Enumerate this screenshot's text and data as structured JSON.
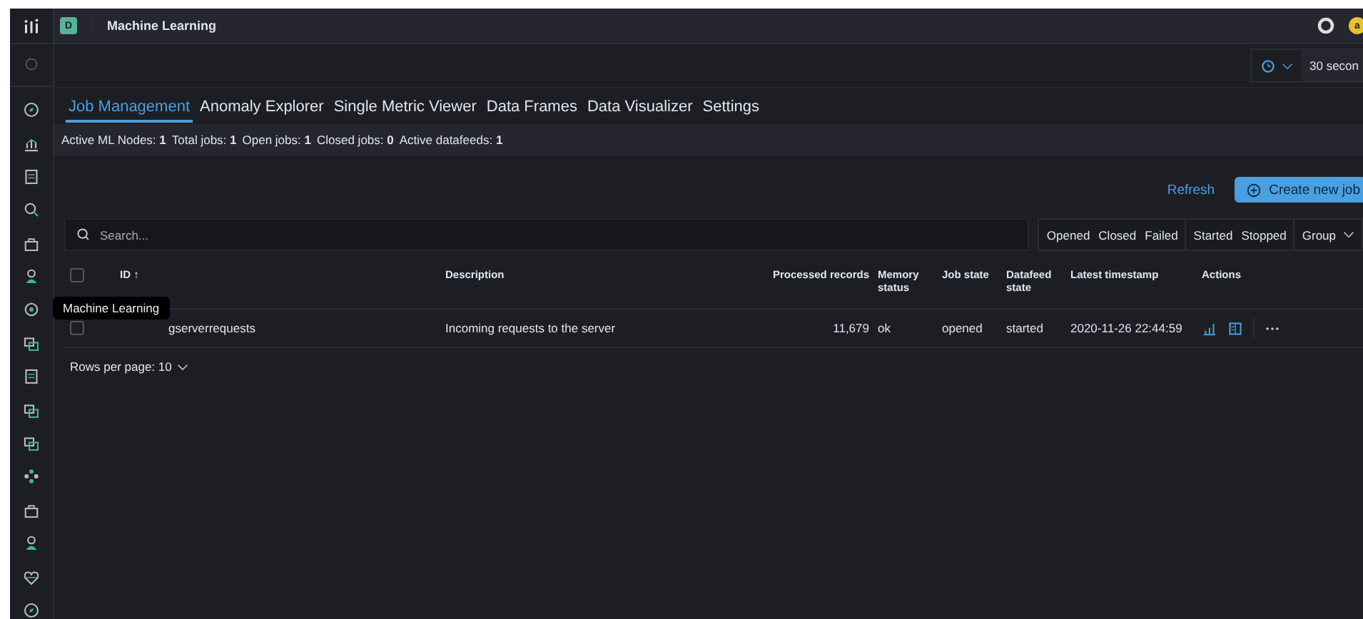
{
  "header": {
    "space_badge": "D",
    "title": "Machine Learning",
    "avatar": "a"
  },
  "refresh_interval": "30 secon",
  "tabs": [
    {
      "label": "Job Management",
      "selected": true
    },
    {
      "label": "Anomaly Explorer",
      "selected": false
    },
    {
      "label": "Single Metric Viewer",
      "selected": false
    },
    {
      "label": "Data Frames",
      "selected": false
    },
    {
      "label": "Data Visualizer",
      "selected": false
    },
    {
      "label": "Settings",
      "selected": false
    }
  ],
  "stats": [
    {
      "label": "Active ML Nodes:",
      "value": "1"
    },
    {
      "label": "Total jobs:",
      "value": "1"
    },
    {
      "label": "Open jobs:",
      "value": "1"
    },
    {
      "label": "Closed jobs:",
      "value": "0"
    },
    {
      "label": "Active datafeeds:",
      "value": "1"
    }
  ],
  "refresh_button": "Refresh",
  "create_button": "Create new job",
  "search": {
    "placeholder": "Search..."
  },
  "filters": [
    [
      "Opened",
      "Closed",
      "Failed"
    ],
    [
      "Started",
      "Stopped"
    ]
  ],
  "group_filter": "Group",
  "table": {
    "all_selected": false,
    "columns": [
      "ID ↑",
      "Description",
      "Processed records",
      "Memory status",
      "Job state",
      "Datafeed state",
      "Latest timestamp",
      "Actions"
    ],
    "rows": [
      {
        "id": "gserverrequests",
        "description": "Incoming requests to the server",
        "processed_records": "11,679",
        "memory_status": "ok",
        "job_state": "opened",
        "datafeed_state": "started",
        "latest_timestamp": "2020-11-26 22:44:59",
        "checked": false
      }
    ]
  },
  "pagination": "Rows per page: 10",
  "tooltip": "Machine Learning"
}
